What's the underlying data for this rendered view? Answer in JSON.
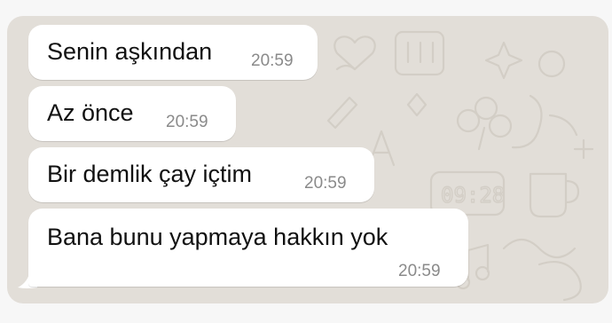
{
  "chat": {
    "messages": [
      {
        "text": "Senin aşkından",
        "time": "20:59"
      },
      {
        "text": "Az önce",
        "time": "20:59"
      },
      {
        "text": "Bir demlik çay içtim",
        "time": "20:59"
      },
      {
        "text": "Bana bunu yapmaya hakkın yok",
        "time": "20:59"
      }
    ]
  },
  "colors": {
    "background": "#e2ded8",
    "bubble": "#ffffff",
    "text": "#111111",
    "time": "#8a8a8a"
  }
}
